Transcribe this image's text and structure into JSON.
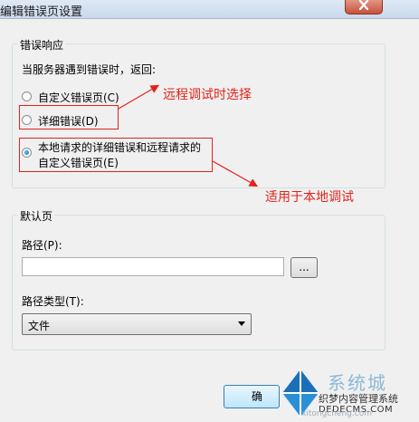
{
  "window": {
    "title": "编辑错误页设置"
  },
  "error_response": {
    "legend": "错误响应",
    "prompt": "当服务器遇到错误时，返回:",
    "options": [
      {
        "label": "自定义错误页(C)",
        "checked": false
      },
      {
        "label": "详细错误(D)",
        "checked": false
      },
      {
        "label_line1": "本地请求的详细错误和远程请求的",
        "label_line2": "自定义错误页(E)",
        "checked": true
      }
    ]
  },
  "annotations": {
    "remote": "远程调试时选择",
    "local": "适用于本地调试",
    "color": "#e2231a"
  },
  "default_page": {
    "legend": "默认页",
    "path_label": "路径(P):",
    "path_value": "",
    "browse_label": "...",
    "path_type_label": "路径类型(T):",
    "path_type_value": "文件"
  },
  "buttons": {
    "ok_partial": "确"
  },
  "watermark": {
    "brand": "系统城",
    "line1": "织梦内容管理系统",
    "line2": "DEDECMS.COM",
    "line3": "xitongcheng.com"
  }
}
